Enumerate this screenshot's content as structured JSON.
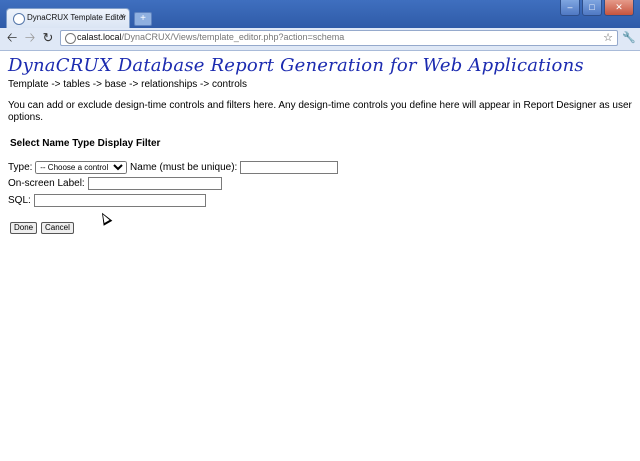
{
  "browser": {
    "tab_title": "DynaCRUX Template Editor",
    "tab_close": "×",
    "new_tab": "+",
    "url_host": "calast.local",
    "url_path": "/DynaCRUX/Views/template_editor.php?action=schema",
    "icons": [
      "back-icon",
      "forward-icon",
      "reload-icon",
      "star-icon",
      "wrench-icon",
      "minimize-icon",
      "maximize-icon",
      "close-icon"
    ]
  },
  "page": {
    "title": "DynaCRUX Database Report Generation for Web Applications",
    "breadcrumb": "Template -> tables -> base -> relationships -> controls",
    "intro": "You can add or exclude design-time controls and filters here. Any design-time controls you define here will appear in Report Designer as user options.",
    "section_title": "Select Name Type Display Filter"
  },
  "form": {
    "type_label": "Type:",
    "type_selected": "-- Choose a control --",
    "name_label": "Name (must be unique):",
    "name_value": "",
    "onscreen_label": "On-screen Label:",
    "onscreen_value": "",
    "sql_label": "SQL:",
    "sql_value": "",
    "done_label": "Done",
    "cancel_label": "Cancel"
  }
}
